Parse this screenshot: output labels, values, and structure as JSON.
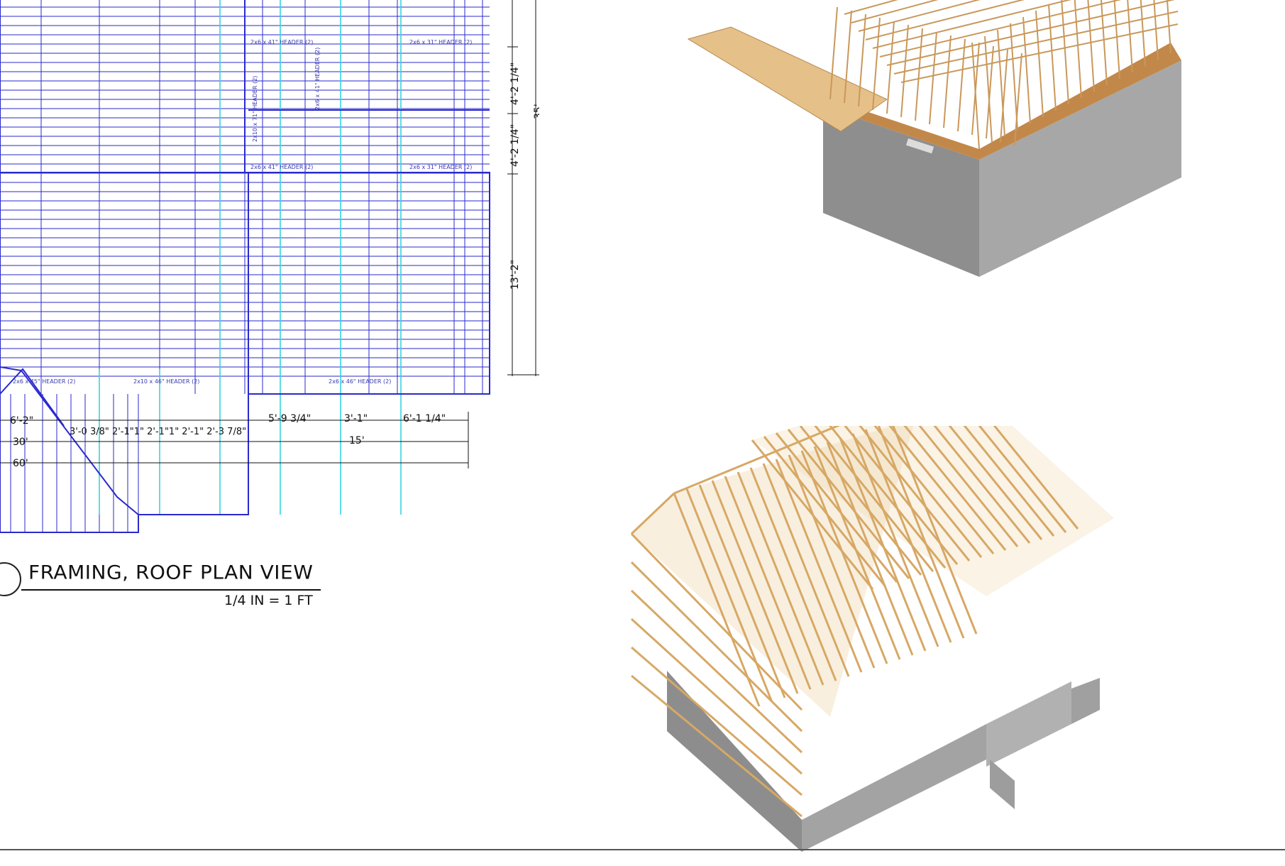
{
  "view_title": "FRAMING, ROOF PLAN VIEW",
  "scale": "1/4 IN = 1 FT",
  "header_labels": {
    "h1": "2x6 x 41\" HEADER (2)",
    "h2": "2x6 x 31\" HEADER (2)",
    "h3": "2x6 x 41\" HEADER (2)",
    "h4": "2x6 x 31\" HEADER (2)",
    "h5": "2x6 x 46\" HEADER (2)",
    "h6": "2x10 x 46\" HEADER (2)",
    "h7": "2x6 x 45\" HEADER (2)",
    "v1": "2x6 x 41\" HEADER (2)",
    "v2": "2x10 x 71\" HEADER (2)"
  },
  "dimensions": {
    "d_4_2_a": "4'-2 1/4\"",
    "d_4_2_b": "4'-2 1/4\"",
    "d_35": "35'",
    "d_13_2": "13'-2\"",
    "d_6_2": "6'-2\"",
    "d_30": "30'",
    "d_60": "60'",
    "d_chain": "3'-0 3/8\"  2'-1\"1\"  2'-1\"1\"  2'-1\"  2'-3 7/8\"",
    "d_5_9": "5'-9 3/4\"",
    "d_3_1": "3'-1\"",
    "d_6_1": "6'-1 1/4\"",
    "d_15": "15'"
  },
  "colors": {
    "plan_lines": "#2a2acc",
    "plan_accent": "#37d3e3",
    "dimension": "#111111",
    "lumber": "#e3c08a",
    "lumber_dark": "#b98a4f",
    "concrete": "#9b9b9b",
    "concrete_dark": "#7e7e7e",
    "deck": "#d9b27a"
  }
}
